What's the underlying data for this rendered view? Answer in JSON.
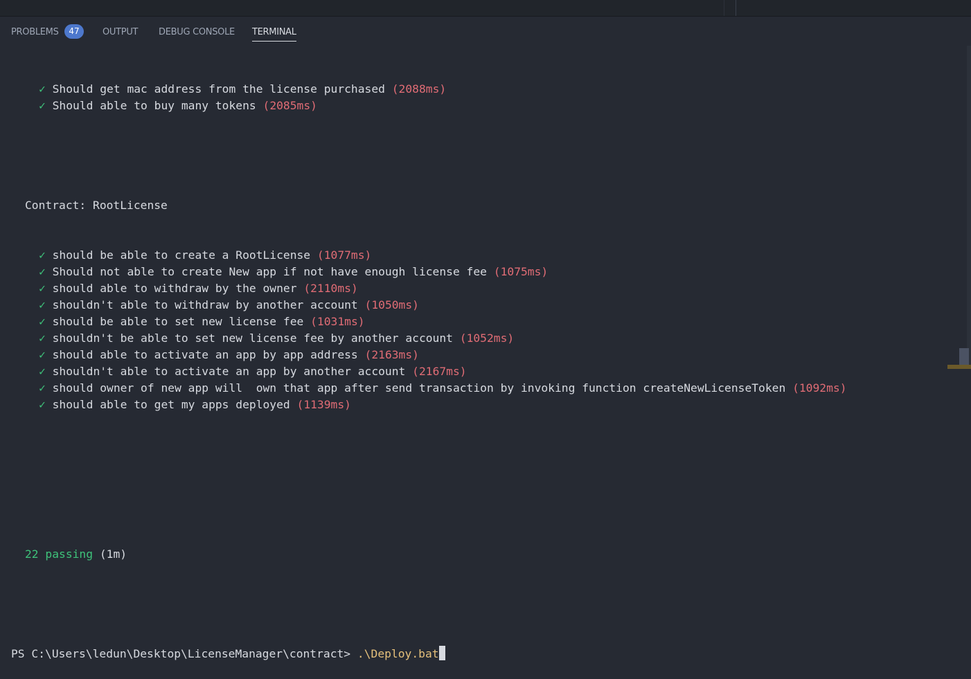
{
  "tabs": [
    {
      "label": "PROBLEMS",
      "badge": "47"
    },
    {
      "label": "OUTPUT"
    },
    {
      "label": "DEBUG CONSOLE"
    },
    {
      "label": "TERMINAL",
      "active": true
    }
  ],
  "terminal": {
    "check_glyph": "✓",
    "prior_tests": [
      {
        "name": "Should get mac address from the license purchased",
        "duration": "(2088ms)"
      },
      {
        "name": "Should able to buy many tokens",
        "duration": "(2085ms)"
      }
    ],
    "suite": "Contract: RootLicense",
    "suite_tests": [
      {
        "name": "should be able to create a RootLicense",
        "duration": "(1077ms)"
      },
      {
        "name": "Should not able to create New app if not have enough license fee",
        "duration": "(1075ms)"
      },
      {
        "name": "should able to withdraw by the owner",
        "duration": "(2110ms)"
      },
      {
        "name": "shouldn't able to withdraw by another account",
        "duration": "(1050ms)"
      },
      {
        "name": "should be able to set new license fee",
        "duration": "(1031ms)"
      },
      {
        "name": "shouldn't be able to set new license fee by another account",
        "duration": "(1052ms)"
      },
      {
        "name": "should able to activate an app by app address",
        "duration": "(2163ms)"
      },
      {
        "name": "shouldn't able to activate an app by another account",
        "duration": "(2167ms)"
      },
      {
        "name": "should owner of new app will  own that app after send transaction by invoking function createNewLicenseToken",
        "duration": "(1092ms)"
      },
      {
        "name": "should able to get my apps deployed",
        "duration": "(1139ms)"
      }
    ],
    "summary": {
      "passing": "22 passing",
      "time": "(1m)"
    },
    "prompt": "PS C:\\Users\\ledun\\Desktop\\LicenseManager\\contract>",
    "command": ".\\Deploy.bat"
  },
  "colors": {
    "background": "#262a33",
    "check": "#3ec27a",
    "duration": "#e06c75",
    "command": "#e5c07b",
    "badge": "#4d78cc"
  }
}
